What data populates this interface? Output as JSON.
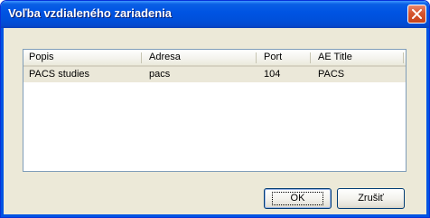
{
  "window": {
    "title": "Voľba vzdialeného zariadenia"
  },
  "icons": {
    "close": "close-x-icon"
  },
  "table": {
    "columns": [
      "Popis",
      "Adresa",
      "Port",
      "AE Title"
    ],
    "rows": [
      [
        "PACS studies",
        "pacs",
        "104",
        "PACS"
      ]
    ],
    "selected_row": 0
  },
  "buttons": {
    "ok": "OK",
    "cancel": "Zrušiť"
  },
  "colors": {
    "titlebar": "#0054e3",
    "dialog_bg": "#ece9d8",
    "close_button": "#d5552f",
    "selected_row_bg": "#ebe8d9"
  }
}
